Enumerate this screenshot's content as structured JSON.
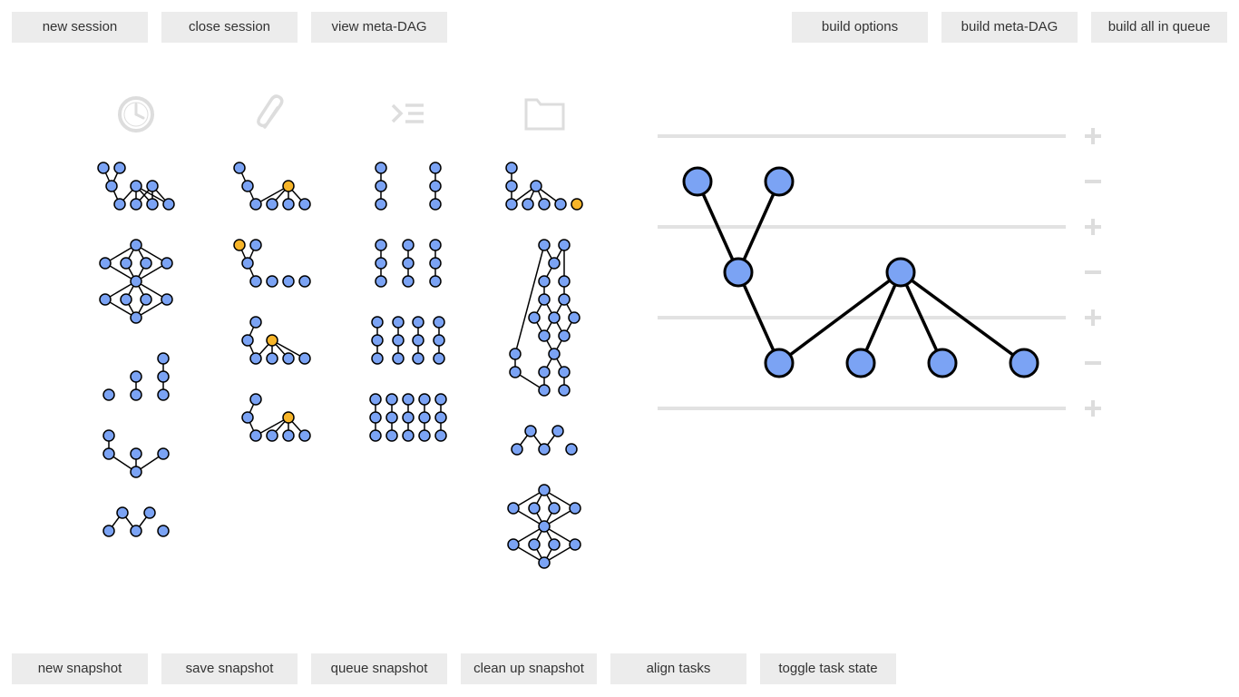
{
  "toolbar_top_left": [
    {
      "name": "new-session-button",
      "label": "new session"
    },
    {
      "name": "close-session-button",
      "label": "close session"
    },
    {
      "name": "view-meta-dag-button",
      "label": "view meta-DAG"
    }
  ],
  "toolbar_top_right": [
    {
      "name": "build-options-button",
      "label": "build options"
    },
    {
      "name": "build-meta-dag-button",
      "label": "build meta-DAG"
    },
    {
      "name": "build-all-in-queue-button",
      "label": "build all in queue"
    }
  ],
  "toolbar_bottom": [
    {
      "name": "new-snapshot-button",
      "label": "new snapshot"
    },
    {
      "name": "save-snapshot-button",
      "label": "save snapshot"
    },
    {
      "name": "queue-snapshot-button",
      "label": "queue snapshot"
    },
    {
      "name": "clean-up-snapshot-button",
      "label": "clean up snapshot"
    },
    {
      "name": "align-tasks-button",
      "label": "align tasks"
    },
    {
      "name": "toggle-task-state-button",
      "label": "toggle task state"
    }
  ],
  "columns": [
    {
      "name": "history",
      "icon": "clock-icon"
    },
    {
      "name": "attachments",
      "icon": "paperclip-icon"
    },
    {
      "name": "queue",
      "icon": "queue-icon"
    },
    {
      "name": "files",
      "icon": "folder-icon"
    }
  ],
  "colors": {
    "node": "#7ba3f4",
    "node_highlight": "#f7b529",
    "edge": "#000000",
    "button_bg": "#ececec",
    "icon": "#dddddd",
    "rule": "#e2e2e2"
  },
  "editor": {
    "row_controls": [
      "+",
      "−",
      "+",
      "−",
      "+",
      "−",
      "+"
    ]
  }
}
